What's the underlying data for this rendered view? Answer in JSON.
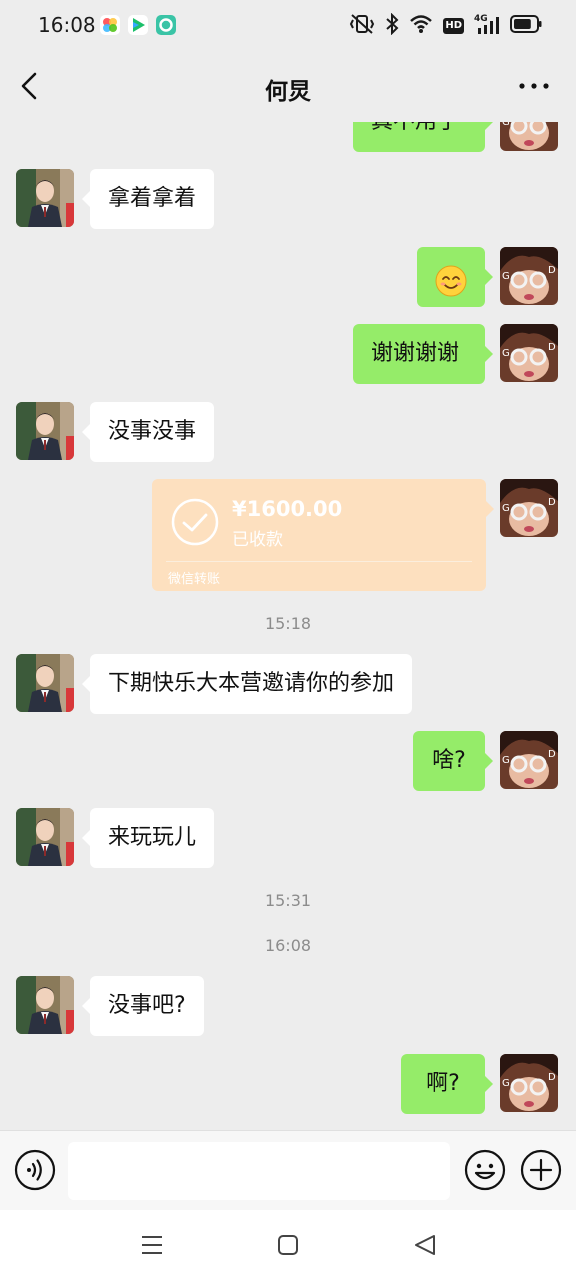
{
  "status_bar": {
    "time": "16:08",
    "app_icons": [
      "photos-app-icon",
      "video-app-icon",
      "camera-app-icon"
    ],
    "right_icons": [
      "vibrate-mute-icon",
      "bluetooth-icon",
      "wifi-icon",
      "hd-icon",
      "4g-signal-icon",
      "battery-icon"
    ],
    "hd_label": "HD",
    "network_label": "4G",
    "battery_level": 0.8
  },
  "navbar": {
    "title": "何炅",
    "back_icon": "chevron-left-icon",
    "more_icon": "more-dots-icon"
  },
  "messages": [
    {
      "side": "right",
      "type": "text",
      "text": "真不用了",
      "clipped": true
    },
    {
      "side": "left",
      "type": "text",
      "text": "拿着拿着"
    },
    {
      "side": "right",
      "type": "emoji",
      "emoji": "😊"
    },
    {
      "side": "right",
      "type": "text",
      "text": "谢谢谢谢"
    },
    {
      "side": "left",
      "type": "text",
      "text": "没事没事"
    },
    {
      "side": "right",
      "type": "transfer",
      "amount": "¥1600.00",
      "status": "已收款",
      "footer": "微信转账"
    },
    {
      "type": "timestamp",
      "text": "15:18"
    },
    {
      "side": "left",
      "type": "text",
      "text": "下期快乐大本营邀请你的参加"
    },
    {
      "side": "right",
      "type": "text",
      "text": "啥?"
    },
    {
      "side": "left",
      "type": "text",
      "text": "来玩玩儿"
    },
    {
      "type": "timestamp",
      "text": "15:31"
    },
    {
      "type": "timestamp",
      "text": "16:08"
    },
    {
      "side": "left",
      "type": "text",
      "text": "没事吧?"
    },
    {
      "side": "right",
      "type": "text",
      "text": "啊?"
    }
  ],
  "input_bar": {
    "voice_icon": "voice-icon",
    "emoji_icon": "emoji-icon",
    "plus_icon": "plus-circle-icon",
    "value": ""
  },
  "system_nav": {
    "icons": [
      "menu-icon",
      "home-icon",
      "back-triangle-icon"
    ]
  },
  "colors": {
    "background": "#ededed",
    "sent_bubble": "#95ec69",
    "received_bubble": "#ffffff",
    "transfer_card": "#fde0bf"
  }
}
